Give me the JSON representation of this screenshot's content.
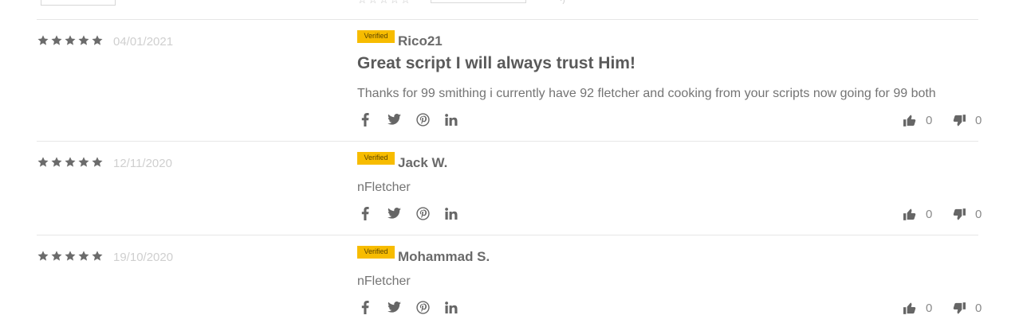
{
  "reviews": [
    {
      "rating": 5,
      "date": "04/01/2021",
      "badge": "Verified",
      "author": "Rico21",
      "title": "Great script I will always trust Him!",
      "body": "Thanks for 99 smithing i currently have 92 fletcher and cooking from your scripts now going for 99 both",
      "upvotes": "0",
      "downvotes": "0"
    },
    {
      "rating": 5,
      "date": "12/11/2020",
      "badge": "Verified",
      "author": "Jack W.",
      "title": "",
      "body": "nFletcher",
      "upvotes": "0",
      "downvotes": "0"
    },
    {
      "rating": 5,
      "date": "19/10/2020",
      "badge": "Verified",
      "author": "Mohammad S.",
      "title": "",
      "body": "nFletcher",
      "upvotes": "0",
      "downvotes": "0"
    }
  ],
  "share_icons": [
    "facebook-icon",
    "twitter-icon",
    "pinterest-icon",
    "linkedin-icon"
  ],
  "vote_icons": [
    "thumbs-up-icon",
    "thumbs-down-icon"
  ],
  "colors": {
    "star": "#6b6b6b",
    "badge_bg": "#f7bc00",
    "divider": "#e6e6e6",
    "date": "#cfcfcf"
  }
}
